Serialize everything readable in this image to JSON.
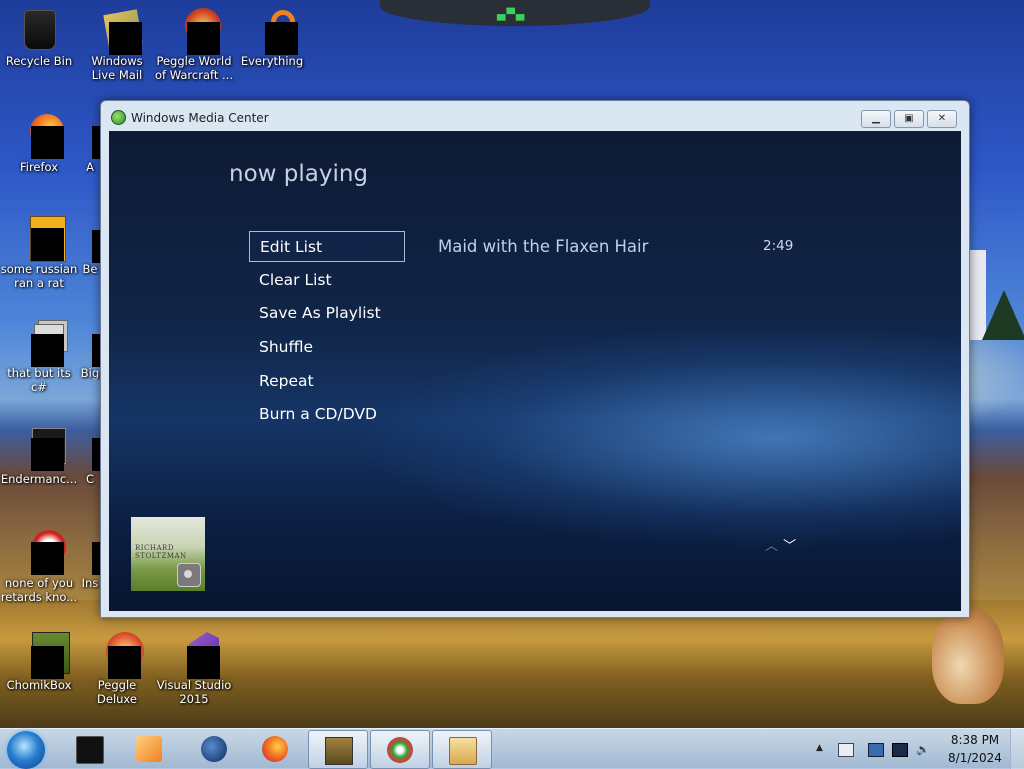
{
  "desktop": {
    "icons": [
      {
        "label": "Recycle Bin",
        "icon": "recycle-bin-icon"
      },
      {
        "label": "Windows Live Mail",
        "icon": "windows-live-mail-icon"
      },
      {
        "label": "Peggle World of Warcraft ...",
        "icon": "peggle-icon"
      },
      {
        "label": "Everything",
        "icon": "everything-search-icon"
      },
      {
        "label": "Firefox",
        "icon": "firefox-icon"
      },
      {
        "label": "A",
        "icon": "app-icon"
      },
      {
        "label": "some russian ran a rat",
        "icon": "app-icon"
      },
      {
        "label": "Be",
        "icon": "app-icon"
      },
      {
        "label": "that but its c#",
        "icon": "folder-stack-icon"
      },
      {
        "label": "Big",
        "icon": "app-icon"
      },
      {
        "label": "Endermanc...",
        "icon": "app-icon"
      },
      {
        "label": "C",
        "icon": "app-icon"
      },
      {
        "label": "none of you retards kno...",
        "icon": "app-icon"
      },
      {
        "label": "Ins",
        "icon": "app-icon"
      },
      {
        "label": "ChomikBox",
        "icon": "chomikbox-icon"
      },
      {
        "label": "Peggle Deluxe",
        "icon": "peggle-icon"
      },
      {
        "label": "Visual Studio 2015",
        "icon": "visual-studio-icon"
      }
    ]
  },
  "window": {
    "title": "Windows Media Center",
    "icon": "media-center-icon",
    "controls": {
      "minimize": "minimize-icon",
      "maximize": "maximize-icon",
      "close": "close-icon"
    }
  },
  "media_center": {
    "page_title": "now playing",
    "menu": [
      "Edit List",
      "Clear List",
      "Save As Playlist",
      "Shuffle",
      "Repeat",
      "Burn a CD/DVD"
    ],
    "selected_menu_item": "Edit List",
    "track": {
      "title": "Maid with the Flaxen Hair",
      "duration": "2:49"
    },
    "album_art": {
      "line1": "RICHARD",
      "line2": "STOLTZMAN"
    },
    "scroll": {
      "up_icon": "chevron-up-icon",
      "down_icon": "chevron-down-icon"
    }
  },
  "taskbar": {
    "start": "windows-start-icon",
    "pinned": [
      "terminal-icon",
      "media-player-icon",
      "globe-icon",
      "firefox-icon",
      "chomikbox-icon",
      "media-center-icon",
      "file-explorer-icon"
    ],
    "active": [
      "chomikbox-icon",
      "media-center-icon",
      "file-explorer-icon"
    ],
    "tray": [
      "show-hidden-icons-icon",
      "message-flag-icon",
      "network-icon",
      "display-icon",
      "volume-icon"
    ],
    "clock": {
      "time": "8:38 PM",
      "date": "8/1/2024"
    }
  },
  "colors": {
    "wmc_background": "#112548",
    "menu_text": "#ffffff",
    "track_text": "#b8d3ef",
    "selection_border": "#a9bcd4"
  }
}
